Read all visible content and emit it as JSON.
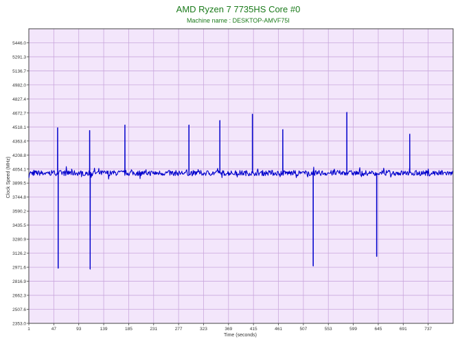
{
  "chart_data": {
    "type": "line",
    "title": "AMD Ryzen 7 7735HS Core #0",
    "subtitle": "Machine name : DESKTOP-AMVF75I",
    "xlabel": "Time (seconds)",
    "ylabel": "Clock Speed (MHz)",
    "xlim": [
      1,
      783
    ],
    "ylim": [
      2353.0,
      5600.6
    ],
    "x_ticks": [
      1,
      47,
      93,
      139,
      185,
      231,
      277,
      323,
      369,
      415,
      461,
      507,
      553,
      599,
      645,
      691,
      737
    ],
    "y_ticks": [
      2353.0,
      2507.6,
      2662.3,
      2816.9,
      2971.6,
      3126.2,
      3280.9,
      3435.5,
      3590.2,
      3744.8,
      3899.5,
      4054.1,
      4208.8,
      4363.4,
      4518.1,
      4672.7,
      4827.4,
      4982.0,
      5136.7,
      5291.3,
      5446.0
    ],
    "y_tick_labels": [
      "2353.0",
      "2507.6",
      "2662.3",
      "2816.9",
      "2971.6",
      "3126.2",
      "3280.9",
      "3435.5",
      "3590.2",
      "3744.8",
      "3899.5",
      "4054.1",
      "4208.8",
      "4363.4",
      "4518.1",
      "4672.7",
      "4827.4",
      "4982.0",
      "5136.7",
      "5291.3",
      "5446.0"
    ],
    "grid": true,
    "colors": {
      "title": "#1a7a1a",
      "plot_bg": "#f3e6fb",
      "grid": "#c9a6dc",
      "line": "#0000cc",
      "axis": "#404040"
    },
    "baseline_mhz": 4010,
    "spikes_up": [
      {
        "x": 54,
        "y": 4510
      },
      {
        "x": 113,
        "y": 4480
      },
      {
        "x": 178,
        "y": 4540
      },
      {
        "x": 296,
        "y": 4540
      },
      {
        "x": 353,
        "y": 4590
      },
      {
        "x": 413,
        "y": 4660
      },
      {
        "x": 469,
        "y": 4490
      },
      {
        "x": 587,
        "y": 4680
      },
      {
        "x": 703,
        "y": 4440
      }
    ],
    "spikes_down": [
      {
        "x": 55,
        "y": 2960
      },
      {
        "x": 114,
        "y": 2950
      },
      {
        "x": 525,
        "y": 2985
      },
      {
        "x": 642,
        "y": 3090
      }
    ]
  }
}
